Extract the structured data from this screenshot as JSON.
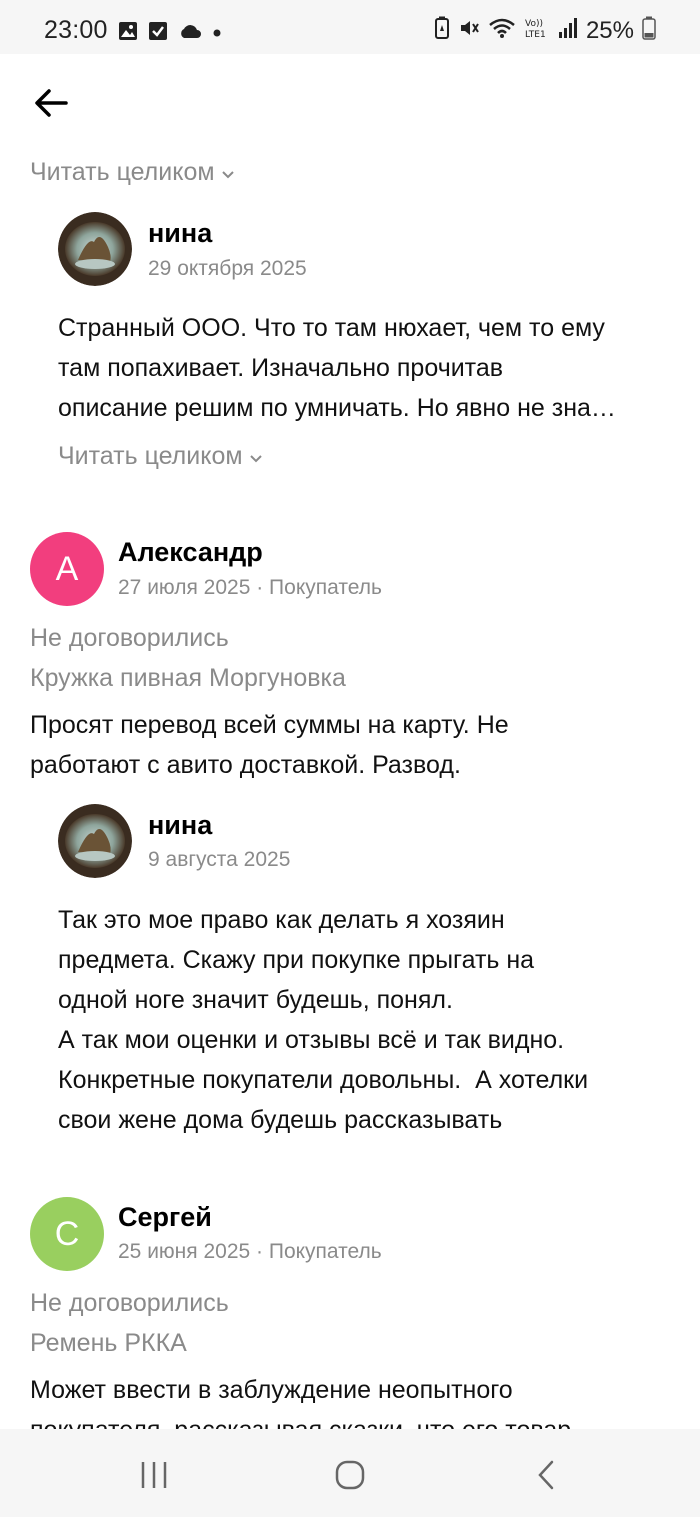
{
  "status_bar": {
    "time": "23:00",
    "battery": "25%",
    "icons_left": [
      "image-icon",
      "check-box-icon",
      "cloud-icon",
      "dot-icon"
    ],
    "icons_right": [
      "battery-saver-icon",
      "mute-icon",
      "wifi-icon",
      "volte-icon",
      "signal-icon",
      "battery-icon"
    ]
  },
  "header": {
    "back_icon": "arrow-left-icon"
  },
  "reviews": [
    {
      "read_more_label": "Читать целиком"
    },
    {
      "reply": {
        "author": "нина",
        "date": "29 октября 2025",
        "lines": [
          "Странный ООО. Что то там нюхает, чем то ему",
          "там попахивает. Изначально прочитав",
          "описание решим по умничать. Но явно не зна…"
        ],
        "read_more_label": "Читать целиком"
      }
    },
    {
      "author": "Александр",
      "avatar_letter": "А",
      "avatar_color": "#f23e7e",
      "date_meta": "27 июля 2025 · Покупатель",
      "status": "Не договорились",
      "item": "Кружка пивная Моргуновка",
      "lines": [
        "Просят перевод всей суммы на карту. Не",
        "работают с авито доставкой. Развод."
      ],
      "reply": {
        "author": "нина",
        "date": "9 августа 2025",
        "lines": [
          "Так это мое право как делать я хозяин",
          "предмета. Скажу при покупке прыгать на",
          "одной ноге значит будешь, понял.",
          "А так мои оценки и отзывы всё и так видно.",
          "Конкретные покупатели довольны.  А хотелки",
          "свои жене дома будешь рассказывать"
        ]
      }
    },
    {
      "author": "Сергей",
      "avatar_letter": "С",
      "avatar_color": "#99cf5f",
      "date_meta": "25 июня 2025 · Покупатель",
      "status": "Не договорились",
      "item": "Ремень РККА",
      "lines": [
        "Может ввести в заблуждение неопытного",
        "покупателя, рассказывая сказки, что его товар"
      ]
    }
  ],
  "nav_bar": {
    "recent_icon": "recent-apps-icon",
    "home_icon": "home-icon",
    "back_icon": "nav-back-icon"
  }
}
